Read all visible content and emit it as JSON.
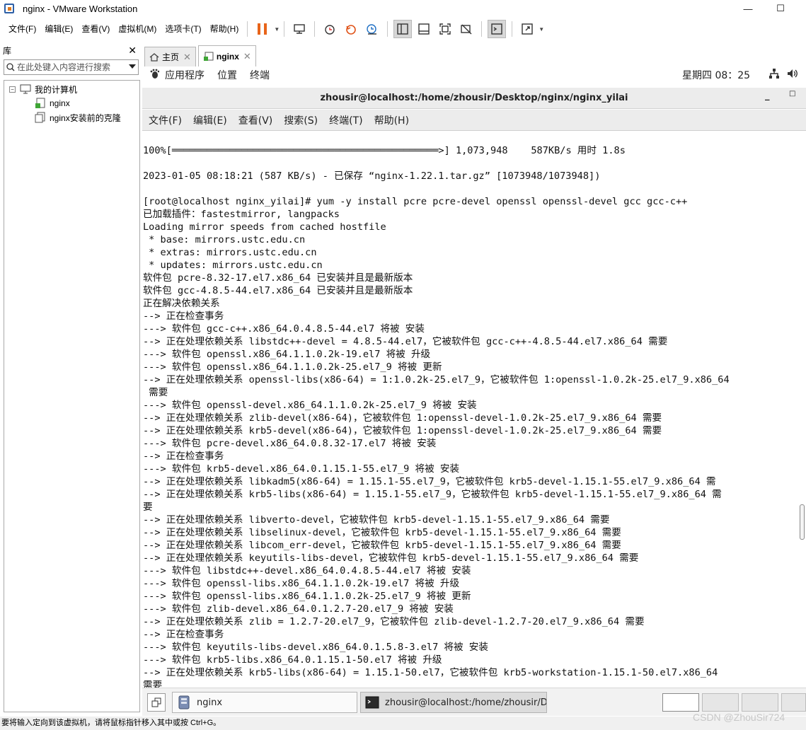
{
  "window": {
    "title": "nginx - VMware Workstation"
  },
  "menu": [
    "文件(F)",
    "编辑(E)",
    "查看(V)",
    "虚拟机(M)",
    "选项卡(T)",
    "帮助(H)"
  ],
  "library": {
    "header": "库",
    "search_placeholder": "在此处键入内容进行搜索",
    "tree": {
      "root": "我的计算机",
      "items": [
        "nginx",
        "nginx安装前的克隆"
      ]
    }
  },
  "tabs": [
    {
      "label": "主页"
    },
    {
      "label": "nginx"
    }
  ],
  "guest": {
    "topbar": {
      "items": [
        "应用程序",
        "位置",
        "终端"
      ],
      "clock": "星期四 08：25"
    },
    "terminal": {
      "title": "zhousir@localhost:/home/zhousir/Desktop/nginx/nginx_yilai",
      "menu": [
        "文件(F)",
        "编辑(E)",
        "查看(V)",
        "搜索(S)",
        "终端(T)",
        "帮助(H)"
      ],
      "lines": [
        "100%[══════════════════════════════════════════════>] 1,073,948    587KB/s 用时 1.8s",
        "",
        "2023-01-05 08:18:21 (587 KB/s) - 已保存 “nginx-1.22.1.tar.gz” [1073948/1073948])",
        "",
        "[root@localhost nginx_yilai]# yum -y install pcre pcre-devel openssl openssl-devel gcc gcc-c++",
        "已加载插件：fastestmirror, langpacks",
        "Loading mirror speeds from cached hostfile",
        " * base: mirrors.ustc.edu.cn",
        " * extras: mirrors.ustc.edu.cn",
        " * updates: mirrors.ustc.edu.cn",
        "软件包 pcre-8.32-17.el7.x86_64 已安装并且是最新版本",
        "软件包 gcc-4.8.5-44.el7.x86_64 已安装并且是最新版本",
        "正在解决依赖关系",
        "--> 正在检查事务",
        "---> 软件包 gcc-c++.x86_64.0.4.8.5-44.el7 将被 安装",
        "--> 正在处理依赖关系 libstdc++-devel = 4.8.5-44.el7，它被软件包 gcc-c++-4.8.5-44.el7.x86_64 需要",
        "---> 软件包 openssl.x86_64.1.1.0.2k-19.el7 将被 升级",
        "---> 软件包 openssl.x86_64.1.1.0.2k-25.el7_9 将被 更新",
        "--> 正在处理依赖关系 openssl-libs(x86-64) = 1:1.0.2k-25.el7_9，它被软件包 1:openssl-1.0.2k-25.el7_9.x86_64",
        " 需要",
        "---> 软件包 openssl-devel.x86_64.1.1.0.2k-25.el7_9 将被 安装",
        "--> 正在处理依赖关系 zlib-devel(x86-64)，它被软件包 1:openssl-devel-1.0.2k-25.el7_9.x86_64 需要",
        "--> 正在处理依赖关系 krb5-devel(x86-64)，它被软件包 1:openssl-devel-1.0.2k-25.el7_9.x86_64 需要",
        "---> 软件包 pcre-devel.x86_64.0.8.32-17.el7 将被 安装",
        "--> 正在检查事务",
        "---> 软件包 krb5-devel.x86_64.0.1.15.1-55.el7_9 将被 安装",
        "--> 正在处理依赖关系 libkadm5(x86-64) = 1.15.1-55.el7_9，它被软件包 krb5-devel-1.15.1-55.el7_9.x86_64 需",
        "--> 正在处理依赖关系 krb5-libs(x86-64) = 1.15.1-55.el7_9，它被软件包 krb5-devel-1.15.1-55.el7_9.x86_64 需",
        "要",
        "--> 正在处理依赖关系 libverto-devel，它被软件包 krb5-devel-1.15.1-55.el7_9.x86_64 需要",
        "--> 正在处理依赖关系 libselinux-devel，它被软件包 krb5-devel-1.15.1-55.el7_9.x86_64 需要",
        "--> 正在处理依赖关系 libcom_err-devel，它被软件包 krb5-devel-1.15.1-55.el7_9.x86_64 需要",
        "--> 正在处理依赖关系 keyutils-libs-devel，它被软件包 krb5-devel-1.15.1-55.el7_9.x86_64 需要",
        "---> 软件包 libstdc++-devel.x86_64.0.4.8.5-44.el7 将被 安装",
        "---> 软件包 openssl-libs.x86_64.1.1.0.2k-19.el7 将被 升级",
        "---> 软件包 openssl-libs.x86_64.1.1.0.2k-25.el7_9 将被 更新",
        "---> 软件包 zlib-devel.x86_64.0.1.2.7-20.el7_9 将被 安装",
        "--> 正在处理依赖关系 zlib = 1.2.7-20.el7_9，它被软件包 zlib-devel-1.2.7-20.el7_9.x86_64 需要",
        "--> 正在检查事务",
        "---> 软件包 keyutils-libs-devel.x86_64.0.1.5.8-3.el7 将被 安装",
        "---> 软件包 krb5-libs.x86_64.0.1.15.1-50.el7 将被 升级",
        "--> 正在处理依赖关系 krb5-libs(x86-64) = 1.15.1-50.el7，它被软件包 krb5-workstation-1.15.1-50.el7.x86_64",
        "需要"
      ]
    },
    "taskbar": [
      "nginx",
      "zhousir@localhost:/home/zhousir/D···"
    ]
  },
  "statusbar": "要将输入定向到该虚拟机，请将鼠标指针移入其中或按 Ctrl+G。",
  "watermark": "CSDN @ZhouSir724"
}
